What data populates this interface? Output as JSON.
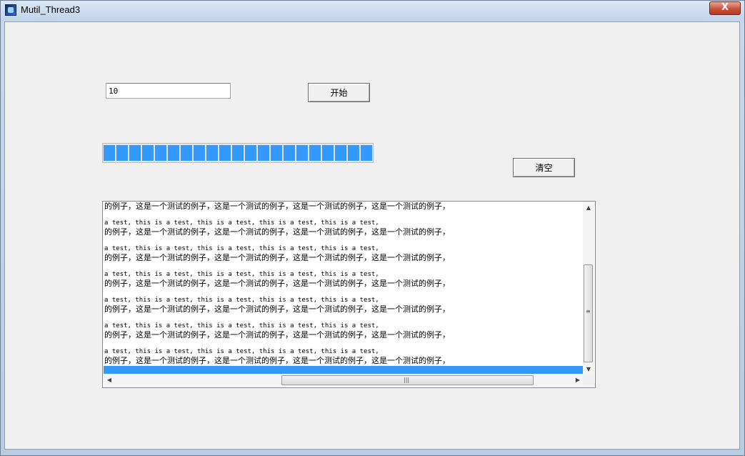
{
  "window": {
    "title": "Mutil_Thread3",
    "close_label": "X"
  },
  "controls": {
    "count_value": "10",
    "start_label": "开始",
    "clear_label": "清空"
  },
  "progress": {
    "filled_segments": 21,
    "total_segments": 21,
    "fraction": 1.0
  },
  "log": {
    "lines": [
      {
        "kind": "cn",
        "text": "的例子，这是一个测试的例子，这是一个测试的例子，这是一个测试的例子，这是一个测试的例子，"
      },
      {
        "kind": "en",
        "text": "a test, this is a test, this is a test, this is a test, this is a test,"
      },
      {
        "kind": "cn",
        "text": "的例子，这是一个测试的例子，这是一个测试的例子，这是一个测试的例子，这是一个测试的例子，"
      },
      {
        "kind": "en",
        "text": "a test, this is a test, this is a test, this is a test, this is a test,"
      },
      {
        "kind": "cn",
        "text": "的例子，这是一个测试的例子，这是一个测试的例子，这是一个测试的例子，这是一个测试的例子，"
      },
      {
        "kind": "en",
        "text": "a test, this is a test, this is a test, this is a test, this is a test,"
      },
      {
        "kind": "cn",
        "text": "的例子，这是一个测试的例子，这是一个测试的例子，这是一个测试的例子，这是一个测试的例子，"
      },
      {
        "kind": "en",
        "text": "a test, this is a test, this is a test, this is a test, this is a test,"
      },
      {
        "kind": "cn",
        "text": "的例子，这是一个测试的例子，这是一个测试的例子，这是一个测试的例子，这是一个测试的例子，"
      },
      {
        "kind": "en",
        "text": "a test, this is a test, this is a test, this is a test, this is a test,"
      },
      {
        "kind": "cn",
        "text": "的例子，这是一个测试的例子，这是一个测试的例子，这是一个测试的例子，这是一个测试的例子，"
      },
      {
        "kind": "en",
        "text": "a test, this is a test, this is a test, this is a test, this is a test,"
      },
      {
        "kind": "cn",
        "text": "的例子，这是一个测试的例子，这是一个测试的例子，这是一个测试的例子，这是一个测试的例子，"
      }
    ]
  },
  "colors": {
    "selection": "#3399ff",
    "progress_fill": "#3399ff",
    "close_button": "#c74c35"
  },
  "icons": {
    "app": "app-icon",
    "close": "close-icon"
  }
}
